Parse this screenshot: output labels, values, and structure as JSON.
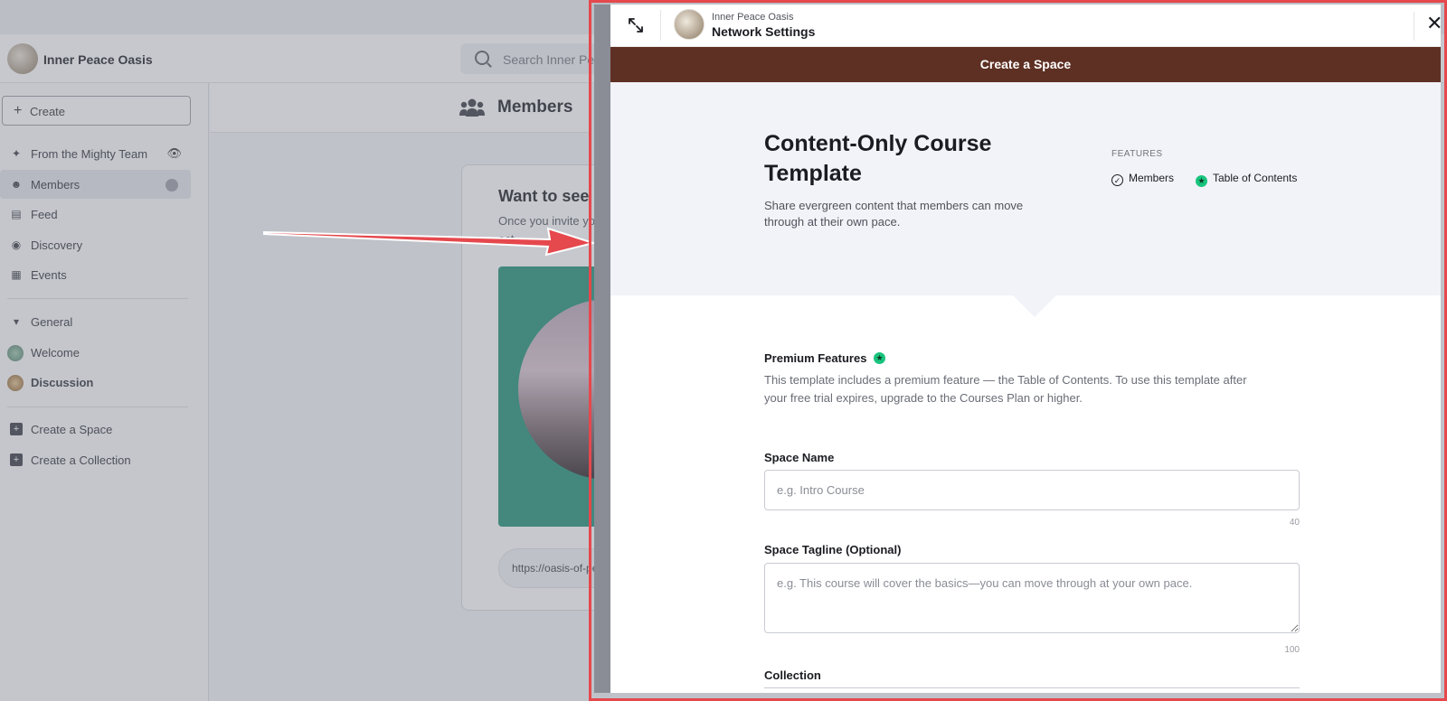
{
  "background": {
    "brand_name": "Inner Peace Oasis",
    "search_placeholder": "Search Inner Peace",
    "create_label": "Create",
    "sidebar": {
      "items": [
        {
          "label": "From the Mighty Team",
          "icon": "sparkle-icon"
        },
        {
          "label": "Members",
          "icon": "members-icon"
        },
        {
          "label": "Feed",
          "icon": "feed-icon"
        },
        {
          "label": "Discovery",
          "icon": "compass-icon"
        },
        {
          "label": "Events",
          "icon": "calendar-icon"
        }
      ],
      "section_label": "General",
      "spaces": [
        {
          "label": "Welcome"
        },
        {
          "label": "Discussion"
        }
      ],
      "create_space": "Create a Space",
      "create_collection": "Create a Collection"
    },
    "main_title": "Members",
    "card": {
      "title": "Want to see m",
      "text_line1": "Once you invite your",
      "text_line2": "ect",
      "link": "https://oasis-of-peac"
    }
  },
  "modal": {
    "org_name": "Inner Peace Oasis",
    "header_title": "Network Settings",
    "bar_title": "Create a Space",
    "template_title_lines": [
      "Content-Only Course",
      "Template"
    ],
    "template_desc_lines": [
      "Share evergreen content that members can move",
      "through at their own pace."
    ],
    "features_label": "FEATURES",
    "features": [
      {
        "label": "Members",
        "icon": "check-circle-icon"
      },
      {
        "label": "Table of Contents",
        "icon": "premium-star-icon"
      }
    ],
    "premium_title": "Premium Features",
    "premium_desc_lines": [
      "This template includes a premium feature — the Table of Contents. To use this template after",
      "your free trial expires, upgrade to the Courses Plan or higher."
    ],
    "space_name_label": "Space Name",
    "space_name_placeholder": "e.g. Intro Course",
    "space_name_max": "40",
    "tagline_label": "Space Tagline (Optional)",
    "tagline_placeholder": "e.g. This course will cover the basics—you can move through at your own pace.",
    "tagline_max": "100",
    "collection_label": "Collection"
  },
  "colors": {
    "accent_bar": "#5e3023",
    "premium_green": "#19c37d",
    "annotation_red": "#e5484d"
  }
}
